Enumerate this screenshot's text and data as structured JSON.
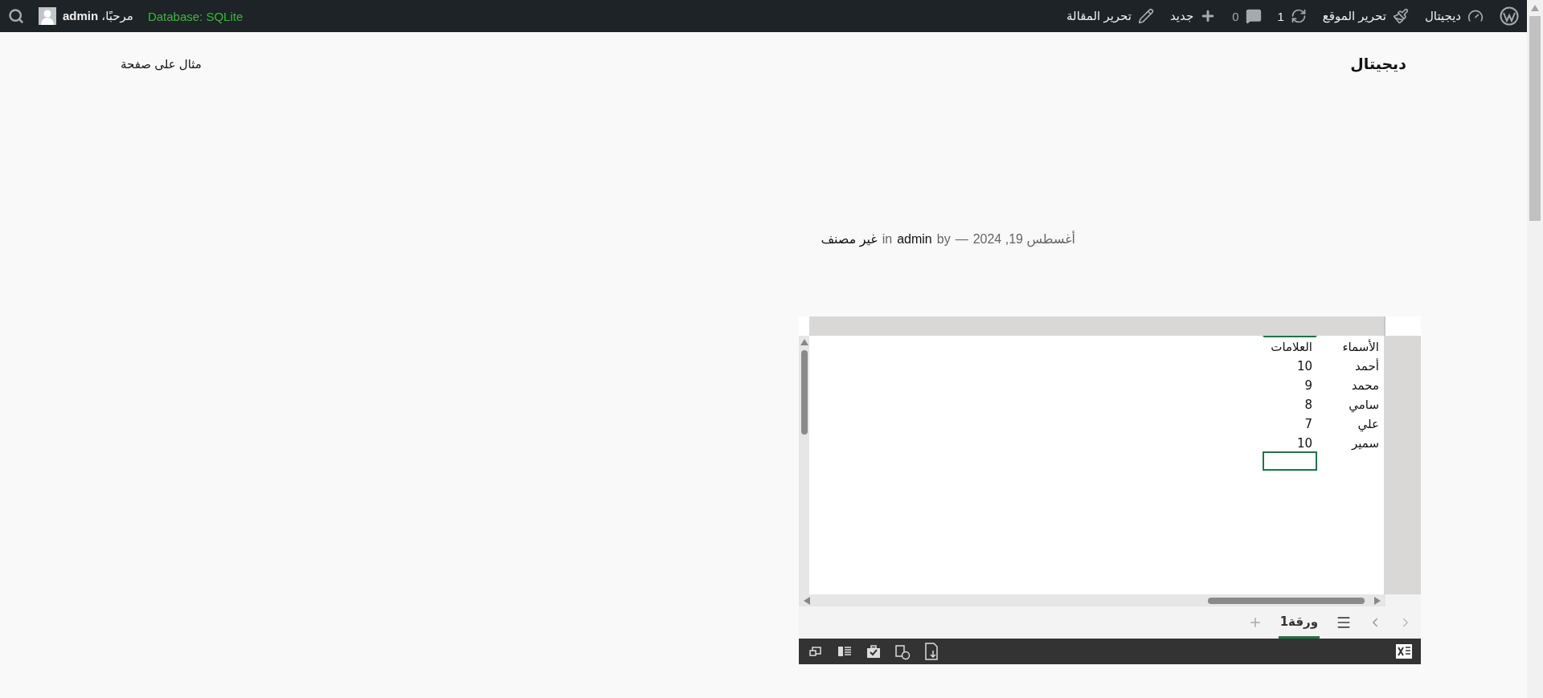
{
  "admin_bar": {
    "right_items": [
      {
        "kind": "logo"
      },
      {
        "kind": "site",
        "label": "ديجيتال"
      },
      {
        "kind": "customize",
        "label": "تحرير الموقع"
      },
      {
        "kind": "updates",
        "label": "1"
      },
      {
        "kind": "comments",
        "label": "0"
      },
      {
        "kind": "new",
        "label": "جديد"
      },
      {
        "kind": "edit",
        "label": "تحرير المقالة"
      }
    ],
    "database": "Database: SQLite",
    "greeting": "مرحبًا،",
    "user": "admin"
  },
  "site_title": "ديجيتال",
  "page_link": "مثال على صفحة",
  "post_meta": {
    "date": "أغسطس 19, 2024",
    "separator": "—",
    "by": "by",
    "author": "admin",
    "in": "in",
    "category": "غير مصنف"
  },
  "spreadsheet": {
    "rows": [
      {
        "cells": [
          {
            "text": "الأسماء",
            "selected": false
          },
          {
            "text": "العلامات",
            "selected": false
          }
        ]
      },
      {
        "cells": [
          {
            "text": "أحمد",
            "selected": false
          },
          {
            "text": "10",
            "selected": false
          }
        ]
      },
      {
        "cells": [
          {
            "text": "محمد",
            "selected": false
          },
          {
            "text": "9",
            "selected": false
          }
        ]
      },
      {
        "cells": [
          {
            "text": "سامي",
            "selected": false
          },
          {
            "text": "8",
            "selected": false
          }
        ]
      },
      {
        "cells": [
          {
            "text": "علي",
            "selected": false
          },
          {
            "text": "7",
            "selected": false
          }
        ]
      },
      {
        "cells": [
          {
            "text": "سمير",
            "selected": false
          },
          {
            "text": "10",
            "selected": false
          }
        ]
      },
      {
        "cells": [
          {
            "selected": false
          },
          {
            "selected": true
          }
        ]
      }
    ],
    "sheet_tabs": [
      {
        "label": "ورقة1",
        "selected": true
      }
    ]
  }
}
